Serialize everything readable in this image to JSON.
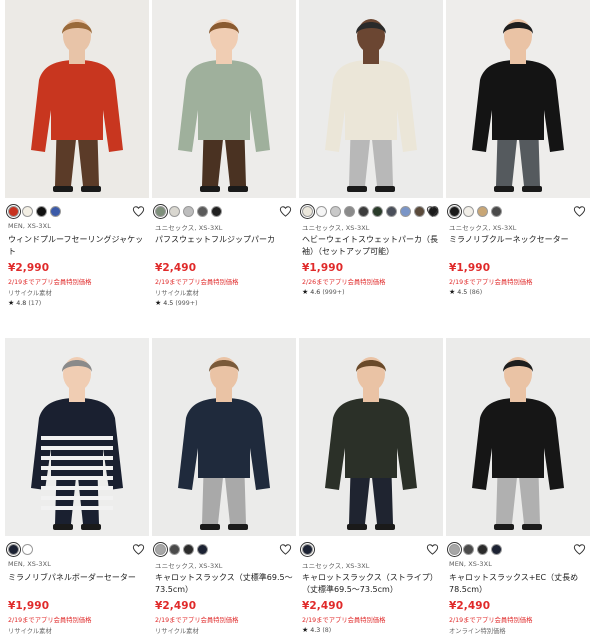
{
  "products": [
    {
      "meta": "MEN, XS-3XL",
      "name": "ウィンドプルーフセーリングジャケット",
      "price": "¥2,990",
      "promo": "2/19までアプリ会員特別価格",
      "extra": "リサイクル素材",
      "rating": "4.8",
      "rating_count": "(17)",
      "swatches": [
        "#c7321f",
        "#f3efe4",
        "#111111",
        "#3b5aa8"
      ],
      "figure": {
        "bg": "#eceae6",
        "top": "#c8361f",
        "bottom": "#5b3b28",
        "skin": "#e8c4a8",
        "hair": "#9a6a3a"
      }
    },
    {
      "meta": "ユニセックス, XS-3XL",
      "name": "パフスウェットフルジップパーカ",
      "price": "¥2,490",
      "promo": "2/19までアプリ会員特別価格",
      "extra": "リサイクル素材",
      "rating": "4.5",
      "rating_count": "(999+)",
      "swatches": [
        "#7e8f7b",
        "#d9d7d0",
        "#bdbdbd",
        "#5a5a5a",
        "#202020"
      ],
      "figure": {
        "bg": "#edecea",
        "top": "#9fb09c",
        "bottom": "#4a3222",
        "skin": "#f0cdb3",
        "hair": "#8a5a30"
      }
    },
    {
      "meta": "ユニセックス, XS-3XL",
      "name": "ヘビーウェイトスウェットパーカ（長袖）（セットアップ可能）",
      "price": "¥1,990",
      "promo": "2/26までアプリ会員特別価格",
      "extra": "",
      "rating": "4.6",
      "rating_count": "(999+)",
      "swatches": [
        "#ece8dc",
        "#f5f5f5",
        "#c9c9c9",
        "#8a8a8a",
        "#3c3c3c",
        "#2a3b2a",
        "#4a4f5a",
        "#7a95c7",
        "#5a4a3a",
        "#1b1b1b"
      ],
      "figure": {
        "bg": "#ebebea",
        "top": "#ebe6d8",
        "bottom": "#b8b8b8",
        "skin": "#6b4632",
        "hair": "#2a2a2a"
      }
    },
    {
      "meta": "ユニセックス, XS-3XL",
      "name": "ミラノリブクルーネックセーター",
      "price": "¥1,990",
      "promo": "2/19までアプリ会員特別価格",
      "extra": "",
      "rating": "4.5",
      "rating_count": "(86)",
      "swatches": [
        "#1a1a1a",
        "#f2efe8",
        "#c8a676",
        "#4a4a4a"
      ],
      "figure": {
        "bg": "#eeedeb",
        "top": "#141414",
        "bottom": "#555a5e",
        "skin": "#eac3a5",
        "hair": "#1e1e1e"
      }
    },
    {
      "meta": "MEN, XS-3XL",
      "name": "ミラノリブパネルボーダーセーター",
      "price": "¥1,990",
      "promo": "2/19までアプリ会員特別価格",
      "extra": "リサイクル素材",
      "rating": "",
      "rating_count": "",
      "swatches": [
        "#1c2233",
        "#ffffff"
      ],
      "figure": {
        "bg": "#ededec",
        "top": "#1a2030",
        "bottom": "#1a2030",
        "skin": "#f0cdb3",
        "hair": "#8a8a8a"
      }
    },
    {
      "meta": "ユニセックス, XS-3XL",
      "name": "キャロットスラックス（丈標準69.5〜73.5cm）",
      "price": "¥2,490",
      "promo": "2/19までアプリ会員特別価格",
      "extra": "リサイクル素材",
      "rating": "",
      "rating_count": "",
      "swatches": [
        "#a7a7a7",
        "#4a4a4a",
        "#2b2b2b",
        "#1c2233"
      ],
      "figure": {
        "bg": "#ebebea",
        "top": "#1f2a3c",
        "bottom": "#a9a9a9",
        "skin": "#eac3a5",
        "hair": "#7a5a3a"
      }
    },
    {
      "meta": "ユニセックス, XS-3XL",
      "name": "キャロットスラックス（ストライプ）（丈標準69.5〜73.5cm）",
      "price": "¥2,490",
      "promo": "2/19までアプリ会員特別価格",
      "extra": "",
      "rating": "4.3",
      "rating_count": "(8)",
      "swatches": [
        "#1c2233"
      ],
      "figure": {
        "bg": "#ebebea",
        "top": "#2b3028",
        "bottom": "#1f2430",
        "skin": "#eac3a5",
        "hair": "#6a4a2a"
      }
    },
    {
      "meta": "MEN, XS-3XL",
      "name": "キャロットスラックス+EC（丈長め78.5cm）",
      "price": "¥2,490",
      "promo": "2/19までアプリ会員特別価格",
      "extra": "オンライン特別価格",
      "rating": "",
      "rating_count": "",
      "swatches": [
        "#a7a7a7",
        "#4a4a4a",
        "#2b2b2b",
        "#1c2233"
      ],
      "figure": {
        "bg": "#ebebea",
        "top": "#161616",
        "bottom": "#b0b0b0",
        "skin": "#eac3a5",
        "hair": "#1e1e1e"
      }
    }
  ]
}
